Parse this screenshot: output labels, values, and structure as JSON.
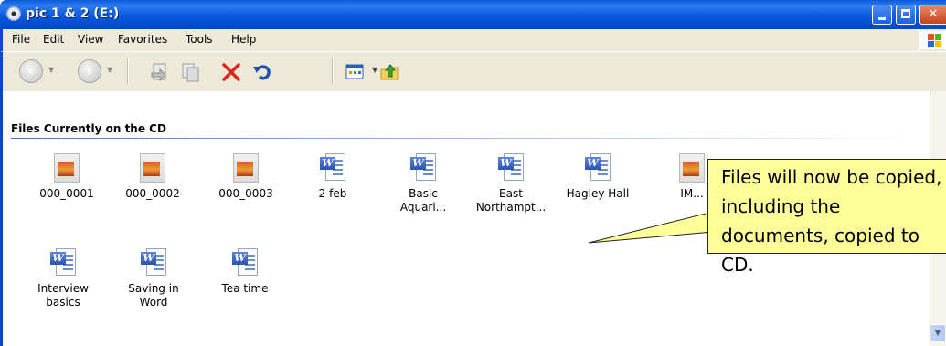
{
  "window": {
    "title": "pic 1 & 2 (E:)"
  },
  "menu": [
    "File",
    "Edit",
    "View",
    "Favorites",
    "Tools",
    "Help"
  ],
  "group": {
    "header": "Files Currently on the CD"
  },
  "files": [
    {
      "label": "000_0001",
      "icon": "image-file-icon"
    },
    {
      "label": "000_0002",
      "icon": "image-file-icon"
    },
    {
      "label": "000_0003",
      "icon": "image-file-icon"
    },
    {
      "label": "2 feb",
      "icon": "word-document-icon"
    },
    {
      "label": "Basic Aquari...",
      "icon": "word-document-icon"
    },
    {
      "label": "East Northampt...",
      "icon": "word-document-icon"
    },
    {
      "label": "Hagley Hall",
      "icon": "word-document-icon"
    },
    {
      "label": "IM...",
      "icon": "image-file-icon"
    },
    {
      "label": "Interview basics",
      "icon": "word-document-icon"
    },
    {
      "label": "Saving in Word",
      "icon": "word-document-icon"
    },
    {
      "label": "Tea time",
      "icon": "word-document-icon"
    }
  ],
  "callout": {
    "text": "Files will now be copied, including the documents, copied to CD."
  },
  "colors": {
    "titlebar": "#0858de",
    "callout_bg": "#ffff99",
    "delete_red": "#e1231c"
  }
}
